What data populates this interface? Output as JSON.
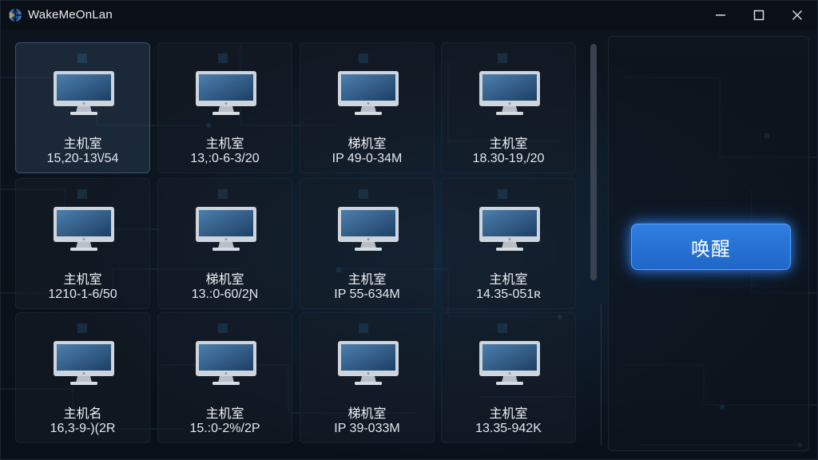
{
  "window": {
    "title": "WakeMeOnLan",
    "app_icon": "globe-icon",
    "controls": [
      "minimize-icon",
      "maximize-icon",
      "close-icon"
    ]
  },
  "devices": [
    {
      "name": "主机室",
      "address": "15,20-13\\/54",
      "icon": "monitor-icon",
      "selected": true
    },
    {
      "name": "主机室",
      "address": "13,:0-6-3/20",
      "icon": "monitor-icon",
      "selected": false
    },
    {
      "name": "梯机室",
      "address": "IP 49-0-34M",
      "icon": "monitor-icon",
      "selected": false
    },
    {
      "name": "主机室",
      "address": "18.30-19,/20",
      "icon": "monitor-icon",
      "selected": false
    },
    {
      "name": "主机室",
      "address": "1210-1-6/50",
      "icon": "monitor-icon",
      "selected": false
    },
    {
      "name": "梯机室",
      "address": "13.:0-60/2Ɲ",
      "icon": "monitor-icon",
      "selected": false
    },
    {
      "name": "主机室",
      "address": "IP 55-634M",
      "icon": "monitor-icon",
      "selected": false
    },
    {
      "name": "主机室",
      "address": "14.35-051ʀ",
      "icon": "monitor-icon",
      "selected": false
    },
    {
      "name": "主机名",
      "address": "16,3-9-)(2R",
      "icon": "monitor-icon",
      "selected": false
    },
    {
      "name": "主机室",
      "address": "15.:0-2%/2P",
      "icon": "monitor-icon",
      "selected": false
    },
    {
      "name": "梯机室",
      "address": "IP 39-033M",
      "icon": "monitor-icon",
      "selected": false
    },
    {
      "name": "主机室",
      "address": "13.35-942K",
      "icon": "monitor-icon",
      "selected": false
    }
  ],
  "actions": {
    "wake_label": "唤醒"
  },
  "colors": {
    "accent": "#2a78dc",
    "background": "#0a1019",
    "tile": "#161e28"
  }
}
